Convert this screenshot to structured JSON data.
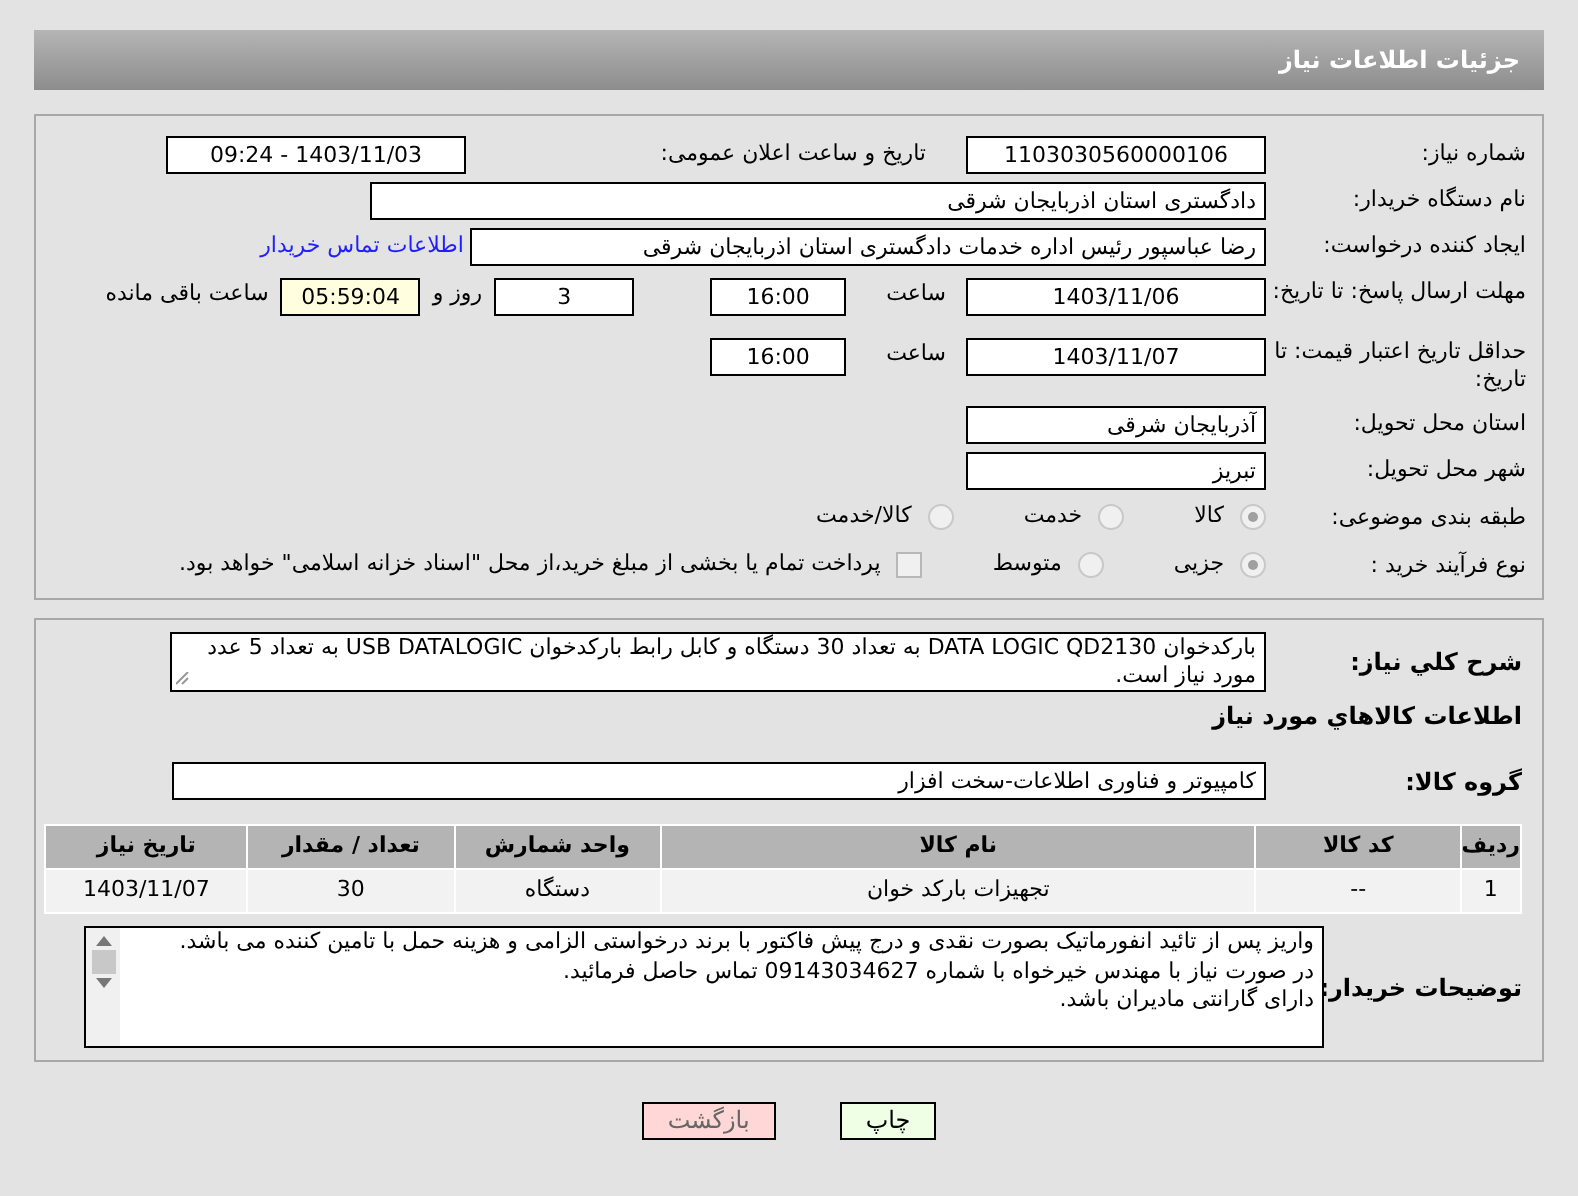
{
  "header": {
    "title": "جزئیات اطلاعات نیاز"
  },
  "need_number": {
    "label": "شماره نیاز:",
    "value": "1103030560000106"
  },
  "announce": {
    "label": "تاریخ و ساعت اعلان عمومی:",
    "value": "1403/11/03 - 09:24"
  },
  "buyer_org": {
    "label": "نام دستگاه خریدار:",
    "value": "دادگستری استان اذربایجان شرقی"
  },
  "requester": {
    "label": "ایجاد کننده درخواست:",
    "value": "رضا عباسپور رئیس اداره خدمات دادگستری استان اذربایجان شرقی",
    "link": "اطلاعات تماس خریدار"
  },
  "deadline": {
    "label": "مهلت ارسال پاسخ: تا تاریخ:",
    "date": "1403/11/06",
    "time_label": "ساعت",
    "time": "16:00",
    "days": "3",
    "days_label": "روز و",
    "remaining": "05:59:04",
    "remaining_label": "ساعت باقی مانده"
  },
  "validity": {
    "label": "حداقل تاریخ اعتبار قیمت: تا تاریخ:",
    "date": "1403/11/07",
    "time_label": "ساعت",
    "time": "16:00"
  },
  "province": {
    "label": "استان محل تحویل:",
    "value": "آذربایجان شرقی"
  },
  "city": {
    "label": "شهر محل تحویل:",
    "value": "تبریز"
  },
  "category": {
    "label": "طبقه بندی موضوعی:",
    "options": [
      {
        "label": "کالا",
        "selected": true
      },
      {
        "label": "خدمت",
        "selected": false
      },
      {
        "label": "کالا/خدمت",
        "selected": false
      }
    ]
  },
  "process": {
    "label": "نوع فرآیند خرید :",
    "options": [
      {
        "label": "جزیی",
        "selected": true
      },
      {
        "label": "متوسط",
        "selected": false
      }
    ],
    "treasury": {
      "label": "پرداخت تمام یا بخشی از مبلغ خرید،از محل \"اسناد خزانه اسلامی\" خواهد بود.",
      "checked": false
    }
  },
  "description": {
    "label": "شرح کلي نياز:",
    "value": "بارکدخوان DATA LOGIC QD2130 به تعداد 30 دستگاه و کابل رابط بارکدخوان USB  DATALOGIC به تعداد 5 عدد مورد نیاز است."
  },
  "goods_heading": "اطلاعات کالاهاي مورد نياز",
  "goods_group": {
    "label": "گروه کالا:",
    "value": "کامپیوتر و فناوری اطلاعات-سخت افزار"
  },
  "table": {
    "columns": [
      "ردیف",
      "کد کالا",
      "نام کالا",
      "واحد شمارش",
      "تعداد / مقدار",
      "تاریخ نیاز"
    ],
    "rows": [
      [
        "1",
        "--",
        "تجهیزات بارکد خوان",
        "دستگاه",
        "30",
        "1403/11/07"
      ]
    ]
  },
  "buyer_notes": {
    "label": "توضیحات خریدار:",
    "lines": [
      "واریز پس از تائید انفورماتیک بصورت نقدی و درج پیش فاکتور با برند درخواستی الزامی و هزینه حمل با تامین کننده می باشد.",
      "در صورت نیاز با مهندس خیرخواه با شماره 09143034627 تماس حاصل فرمائید.",
      "دارای گارانتی مادیران باشد."
    ]
  },
  "buttons": [
    {
      "label": "چاپ",
      "kind": "print"
    },
    {
      "label": "بازگشت",
      "kind": "back"
    }
  ]
}
